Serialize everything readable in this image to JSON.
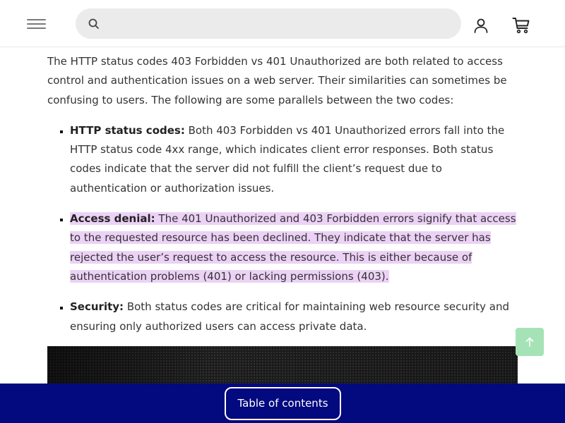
{
  "header": {
    "search_placeholder": "",
    "icons": {
      "menu": "hamburger-menu-icon",
      "search": "search-icon",
      "account": "user-icon",
      "cart": "shopping-cart-icon"
    }
  },
  "article": {
    "intro": "The HTTP status codes 403 Forbidden vs 401 Unauthorized are both related to access control and authentication issues on a web server. Their similarities can sometimes be confusing to users. The following are some parallels between the two codes:",
    "items": [
      {
        "label": "HTTP status codes:",
        "text": " Both 403 Forbidden vs 401 Unauthorized errors fall into the HTTP status code 4xx range, which indicates client error responses. Both status codes indicate that the server did not fulfill the client’s request due to authentication or authorization issues."
      },
      {
        "label": "Access denial:",
        "text": " The 401 Unauthorized and 403 Forbidden errors signify that access to the requested resource has been declined. They indicate that the server has rejected the user’s request to access the resource. This is either because of authentication problems (401) or lacking permissions (403)."
      },
      {
        "label": "Security:",
        "text": " Both status codes are critical for maintaining web resource security and ensuring only authorized users can access private data."
      }
    ]
  },
  "colors": {
    "highlight": "#ecd2f6",
    "bottom_bar": "#03097f",
    "scroll_top": "#a5e3b6"
  },
  "footer": {
    "toc_label": "Table of contents"
  }
}
